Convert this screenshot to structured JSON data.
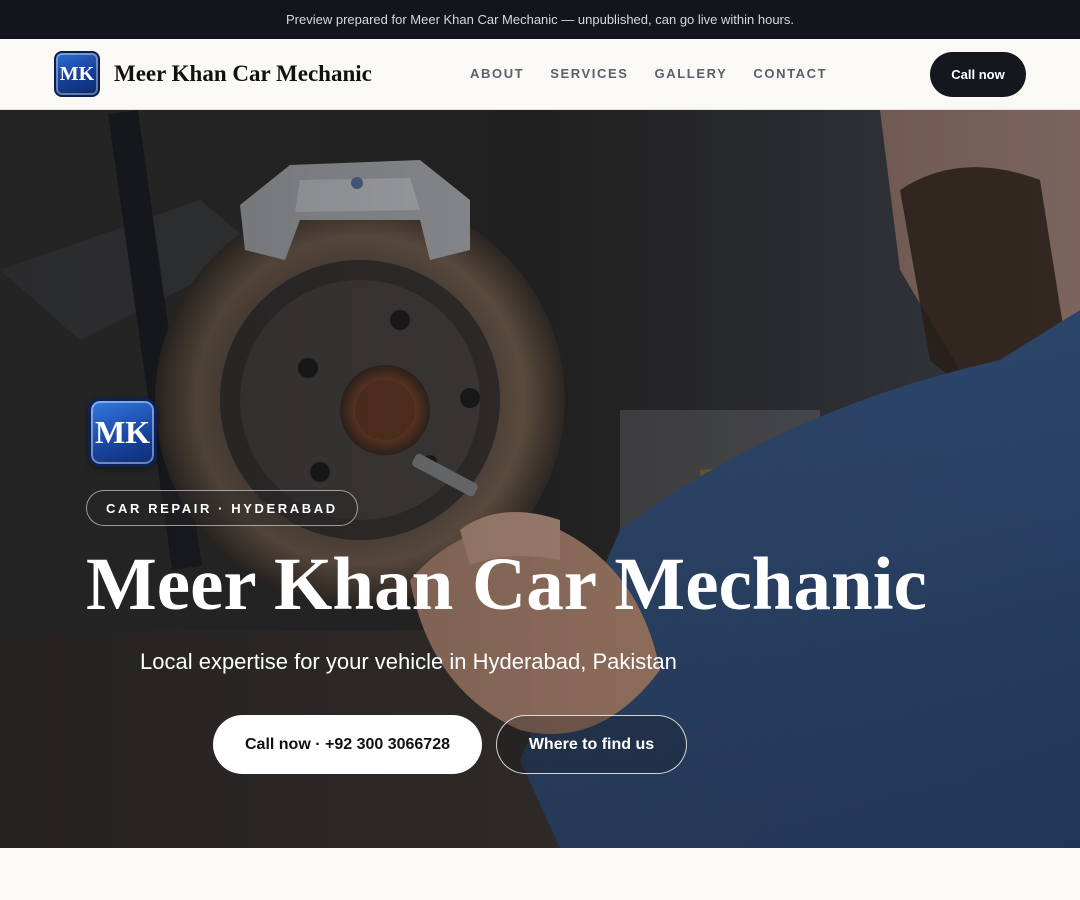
{
  "banner": {
    "text": "Preview prepared for Meer Khan Car Mechanic — unpublished, can go live within hours."
  },
  "navbar": {
    "logo_text": "MK",
    "brand_name": "Meer Khan Car Mechanic",
    "links": [
      "ABOUT",
      "SERVICES",
      "GALLERY",
      "CONTACT"
    ],
    "cta_label": "Call now"
  },
  "hero": {
    "logo_text": "MK",
    "tag": "CAR REPAIR · HYDERABAD",
    "title": "Meer Khan Car Mechanic",
    "subtitle": "Local expertise for your vehicle in Hyderabad, Pakistan",
    "primary_button": "Call now · +92 300 3066728",
    "secondary_button": "Where to find us"
  },
  "colors": {
    "dark": "#12151c",
    "accent_blue": "#1a48a3",
    "page_bg": "#faf9f6"
  }
}
